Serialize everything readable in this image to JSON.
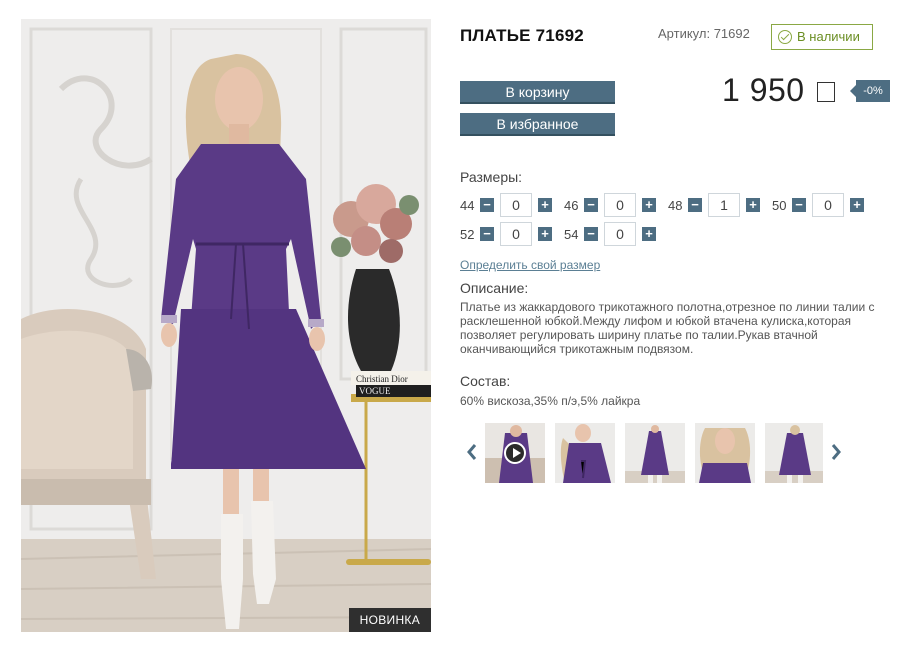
{
  "product": {
    "title": "ПЛАТЬЕ 71692",
    "sku_label": "Артикул:",
    "sku_value": "71692",
    "stock_status": "В наличии",
    "badge": "НОВИНКА",
    "price": "1 950",
    "discount": "-0%"
  },
  "actions": {
    "add_to_cart": "В корзину",
    "add_to_favorites": "В избранное"
  },
  "sizes": {
    "label": "Размеры:",
    "items": [
      {
        "size": "44",
        "qty": "0"
      },
      {
        "size": "46",
        "qty": "0"
      },
      {
        "size": "48",
        "qty": "1"
      },
      {
        "size": "50",
        "qty": "0"
      },
      {
        "size": "52",
        "qty": "0"
      },
      {
        "size": "54",
        "qty": "0"
      }
    ],
    "size_link": "Определить свой размер"
  },
  "description": {
    "label": "Описание:",
    "text": "Платье из жаккардового трикотажного полотна,отрезное по линии талии с расклешенной юбкой.Между лифом и юбкой втачена кулиска,которая позволяет регулировать ширину платье по талии.Рукав втачной оканчивающийся трикотажным подвязом."
  },
  "composition": {
    "label": "Состав:",
    "text": "60% вискоза,35% п/э,5% лайкра"
  },
  "photo_props": {
    "book_1": "Christian Dior",
    "book_2": "VOGUE"
  },
  "colors": {
    "accent": "#4d6d82",
    "in_stock": "#8aa844",
    "dress": "#5a3a86"
  },
  "thumbnails": [
    {
      "kind": "video"
    },
    {
      "kind": "photo"
    },
    {
      "kind": "photo"
    },
    {
      "kind": "photo"
    },
    {
      "kind": "photo"
    }
  ]
}
